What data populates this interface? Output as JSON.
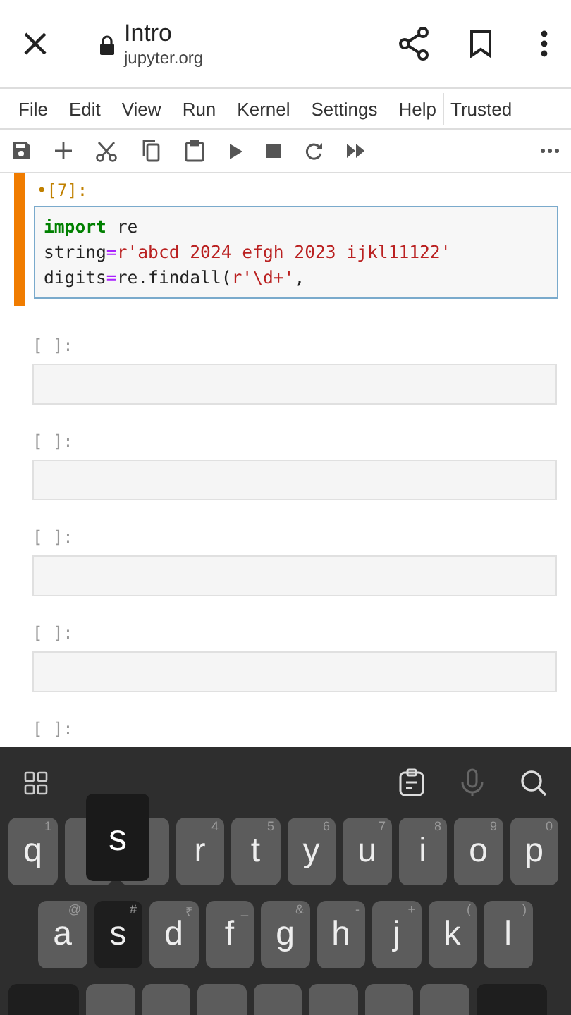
{
  "browser_bar": {
    "title": "Intro",
    "url": "jupyter.org"
  },
  "menu": [
    "File",
    "Edit",
    "View",
    "Run",
    "Kernel",
    "Settings",
    "Help"
  ],
  "trusted": "Trusted",
  "active_cell": {
    "prompt": "•[7]:",
    "lines": [
      [
        {
          "kind": "keyword",
          "text": "import"
        },
        {
          "kind": "plain",
          "text": " re"
        }
      ],
      [
        {
          "kind": "plain",
          "text": "string"
        },
        {
          "kind": "operator",
          "text": "="
        },
        {
          "kind": "string",
          "text": "r'abcd 2024 efgh 2023 ijkl11122'"
        }
      ],
      [
        {
          "kind": "plain",
          "text": "digits"
        },
        {
          "kind": "operator",
          "text": "="
        },
        {
          "kind": "plain",
          "text": "re.findall("
        },
        {
          "kind": "string",
          "text": "r'\\d+'"
        },
        {
          "kind": "plain",
          "text": ","
        }
      ]
    ]
  },
  "empty_cells": [
    {
      "prompt": "[ ]:"
    },
    {
      "prompt": "[ ]:"
    },
    {
      "prompt": "[ ]:"
    },
    {
      "prompt": "[ ]:"
    },
    {
      "prompt": "[ ]:"
    }
  ],
  "keyboard": {
    "popup": "s",
    "rows": [
      [
        {
          "label": "q",
          "hint": "1"
        },
        {
          "kind": "covered"
        },
        {
          "kind": "covered"
        },
        {
          "label": "r",
          "hint": "4"
        },
        {
          "label": "t",
          "hint": "5"
        },
        {
          "label": "y",
          "hint": "6"
        },
        {
          "label": "u",
          "hint": "7"
        },
        {
          "label": "i",
          "hint": "8"
        },
        {
          "label": "o",
          "hint": "9"
        },
        {
          "label": "p",
          "hint": "0"
        }
      ],
      [
        {
          "label": "a",
          "hint": "@"
        },
        {
          "label": "s",
          "hint": "#",
          "pressed": true
        },
        {
          "label": "d",
          "hint": "₹"
        },
        {
          "label": "f",
          "hint": "_"
        },
        {
          "label": "g",
          "hint": "&"
        },
        {
          "label": "h",
          "hint": "-"
        },
        {
          "label": "j",
          "hint": "+"
        },
        {
          "label": "k",
          "hint": "("
        },
        {
          "label": "l",
          "hint": ")"
        }
      ],
      [
        {
          "kind": "shift"
        },
        {
          "kind": "blank"
        },
        {
          "kind": "blank"
        },
        {
          "kind": "blank"
        },
        {
          "kind": "blank"
        },
        {
          "kind": "blank"
        },
        {
          "kind": "blank"
        },
        {
          "kind": "blank"
        },
        {
          "kind": "backspace"
        }
      ]
    ]
  }
}
